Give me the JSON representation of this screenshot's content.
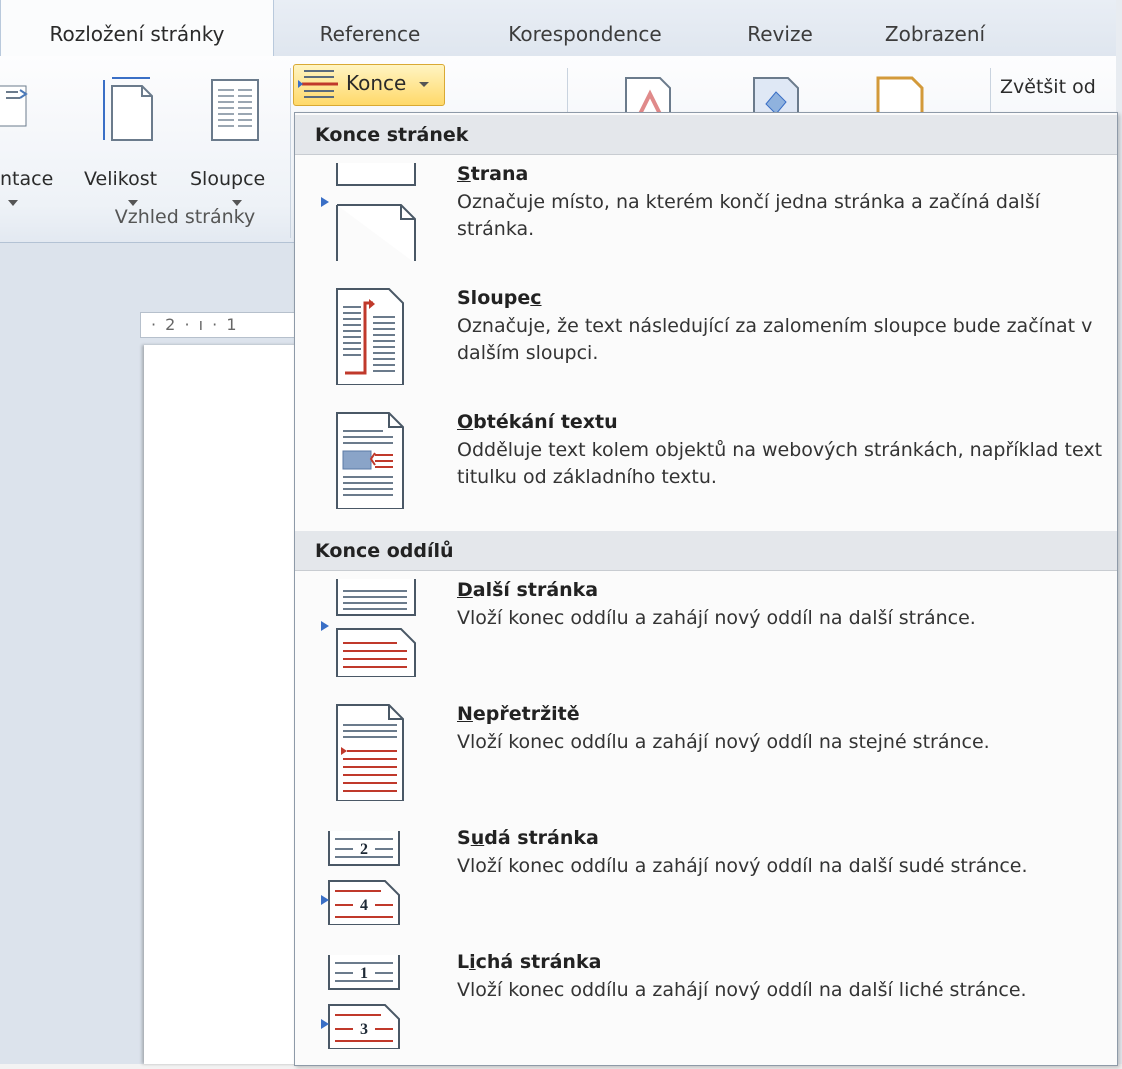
{
  "tabs": [
    {
      "label": "Rozložení stránky",
      "active": true
    },
    {
      "label": "Reference"
    },
    {
      "label": "Korespondence"
    },
    {
      "label": "Revize"
    },
    {
      "label": "Zobrazení"
    }
  ],
  "ribbon": {
    "orientation_label": "ntace",
    "size_label": "Velikost",
    "columns_label": "Sloupce",
    "group_label": "Vzhled stránky",
    "breaks_label": "Konce",
    "zoom_label": "Zvětšit od"
  },
  "ruler_text": "· 2 · ı · 1",
  "menu": {
    "section1": "Konce stránek",
    "section2": "Konce oddílů",
    "items": [
      {
        "pre": "",
        "u": "S",
        "post": "trana",
        "desc": "Označuje místo, na kterém končí jedna stránka a začíná další stránka."
      },
      {
        "pre": "Sloupe",
        "u": "c",
        "post": "",
        "desc": "Označuje, že text následující za zalomením sloupce bude začínat v dalším sloupci."
      },
      {
        "pre": "",
        "u": "O",
        "post": "btékání textu",
        "desc": "Odděluje text kolem objektů na webových stránkách, například text titulku od základního textu."
      },
      {
        "pre": "",
        "u": "D",
        "post": "alší stránka",
        "desc": "Vloží konec oddílu a zahájí nový oddíl na další stránce."
      },
      {
        "pre": "",
        "u": "N",
        "post": "epřetržitě",
        "desc": "Vloží konec oddílu a zahájí nový oddíl na stejné stránce."
      },
      {
        "pre": "S",
        "u": "u",
        "post": "dá stránka",
        "desc": "Vloží konec oddílu a zahájí nový oddíl na další sudé stránce."
      },
      {
        "pre": "L",
        "u": "i",
        "post": "chá stránka",
        "desc": "Vloží konec oddílu a zahájí nový oddíl na další liché stránce."
      }
    ],
    "icon_numbers": {
      "even_top": "2",
      "even_bottom": "4",
      "odd_top": "1",
      "odd_bottom": "3"
    }
  },
  "colors": {
    "accent_red": "#c0392b",
    "highlight_yellow": "#ffd96a",
    "arrow_blue": "#3a6fc6"
  }
}
